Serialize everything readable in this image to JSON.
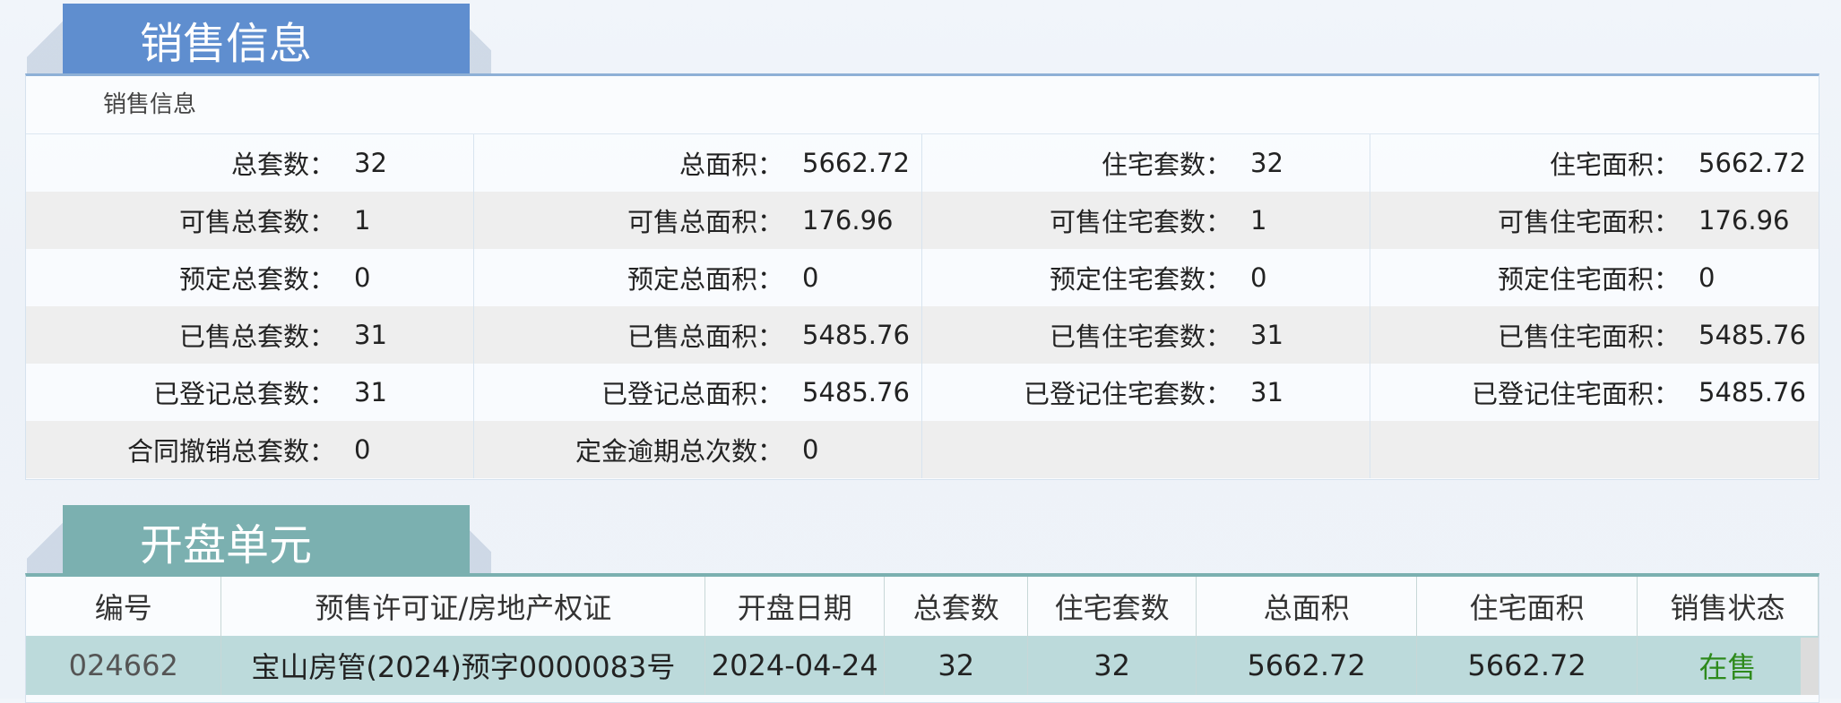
{
  "sales_section": {
    "tab_title": "销售信息",
    "sub_title": "销售信息",
    "rows": [
      [
        {
          "label": "总套数",
          "value": "32"
        },
        {
          "label": "总面积",
          "value": "5662.72"
        },
        {
          "label": "住宅套数",
          "value": "32"
        },
        {
          "label": "住宅面积",
          "value": "5662.72"
        }
      ],
      [
        {
          "label": "可售总套数",
          "value": "1"
        },
        {
          "label": "可售总面积",
          "value": "176.96"
        },
        {
          "label": "可售住宅套数",
          "value": "1"
        },
        {
          "label": "可售住宅面积",
          "value": "176.96"
        }
      ],
      [
        {
          "label": "预定总套数",
          "value": "0"
        },
        {
          "label": "预定总面积",
          "value": "0"
        },
        {
          "label": "预定住宅套数",
          "value": "0"
        },
        {
          "label": "预定住宅面积",
          "value": "0"
        }
      ],
      [
        {
          "label": "已售总套数",
          "value": "31"
        },
        {
          "label": "已售总面积",
          "value": "5485.76"
        },
        {
          "label": "已售住宅套数",
          "value": "31"
        },
        {
          "label": "已售住宅面积",
          "value": "5485.76"
        }
      ],
      [
        {
          "label": "已登记总套数",
          "value": "31"
        },
        {
          "label": "已登记总面积",
          "value": "5485.76"
        },
        {
          "label": "已登记住宅套数",
          "value": "31"
        },
        {
          "label": "已登记住宅面积",
          "value": "5485.76"
        }
      ],
      [
        {
          "label": "合同撤销总套数",
          "value": "0"
        },
        {
          "label": "定金逾期总次数",
          "value": "0"
        },
        {
          "label": "",
          "value": ""
        },
        {
          "label": "",
          "value": ""
        }
      ]
    ],
    "colon": "："
  },
  "units_section": {
    "tab_title": "开盘单元",
    "columns": [
      "编号",
      "预售许可证/房地产权证",
      "开盘日期",
      "总套数",
      "住宅套数",
      "总面积",
      "住宅面积",
      "销售状态"
    ],
    "rows": [
      [
        "024662",
        "宝山房管(2024)预字0000083号",
        "2024-04-24",
        "32",
        "32",
        "5662.72",
        "5662.72",
        "在售"
      ]
    ]
  },
  "colors": {
    "sales_tab": "#5f8ecf",
    "units_tab": "#7bb0b0",
    "row_highlight": "#bcdadb",
    "status_on_sale": "#2e8a1c"
  }
}
